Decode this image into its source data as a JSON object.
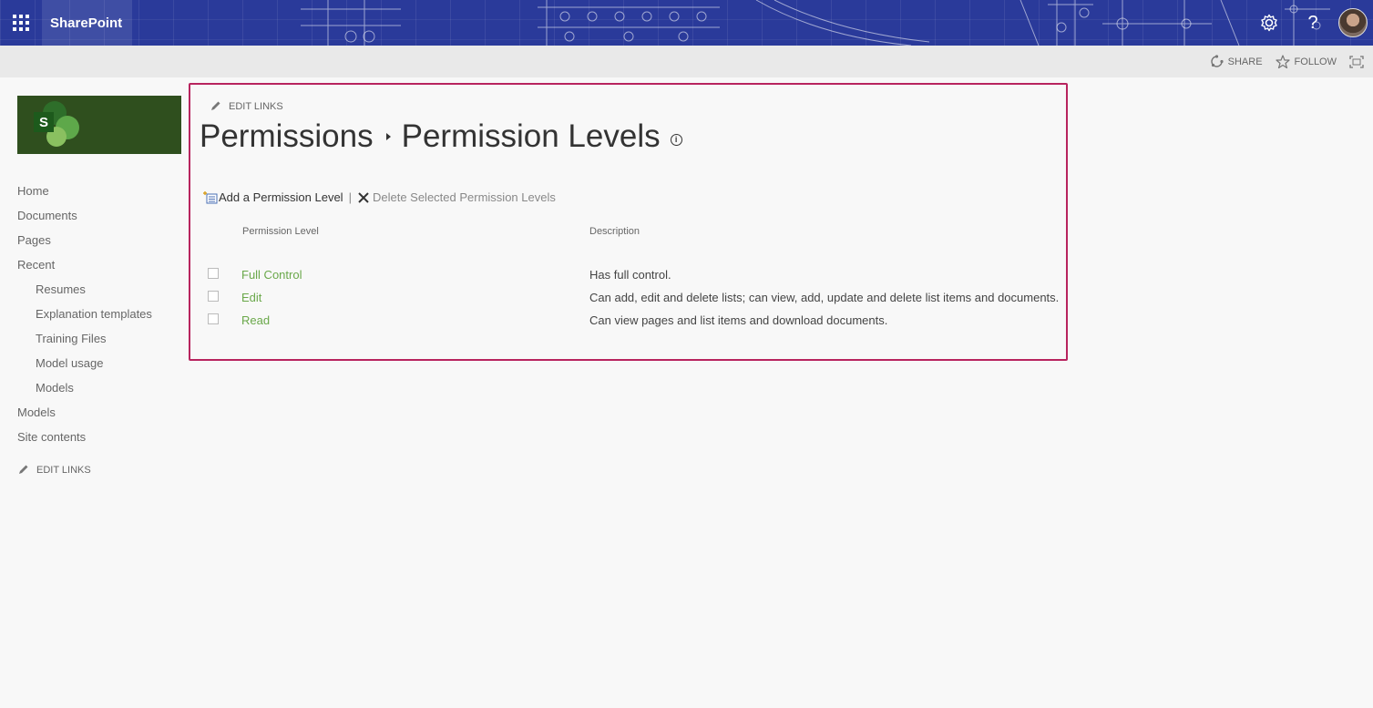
{
  "suite": {
    "brand": "SharePoint",
    "help_label": "?"
  },
  "ribbon": {
    "share_label": "SHARE",
    "follow_label": "FOLLOW"
  },
  "logo": {
    "letter": "S"
  },
  "leftnav": {
    "items": [
      {
        "label": "Home",
        "level": 0
      },
      {
        "label": "Documents",
        "level": 0
      },
      {
        "label": "Pages",
        "level": 0
      },
      {
        "label": "Recent",
        "level": 0
      },
      {
        "label": "Resumes",
        "level": 1
      },
      {
        "label": "Explanation templates",
        "level": 1
      },
      {
        "label": "Training Files",
        "level": 1
      },
      {
        "label": "Model usage",
        "level": 1
      },
      {
        "label": "Models",
        "level": 1
      },
      {
        "label": "Models",
        "level": 0
      },
      {
        "label": "Site contents",
        "level": 0
      }
    ],
    "edit_links": "EDIT LINKS"
  },
  "main": {
    "edit_links": "EDIT LINKS",
    "breadcrumb": [
      "Permissions",
      "Permission Levels"
    ],
    "info_icon": "i",
    "toolbar": {
      "add_label": "Add a Permission Level",
      "separator": "|",
      "delete_label": "Delete Selected Permission Levels"
    },
    "table": {
      "headers": {
        "level": "Permission Level",
        "description": "Description"
      },
      "rows": [
        {
          "level": "Full Control",
          "description": "Has full control."
        },
        {
          "level": "Edit",
          "description": "Can add, edit and delete lists; can view, add, update and delete list items and documents."
        },
        {
          "level": "Read",
          "description": "Can view pages and list items and download documents."
        }
      ]
    }
  },
  "colors": {
    "suitebar": "#2a3a9a",
    "link_green": "#6aa84a",
    "highlight_border": "#b8245e",
    "logo_bg": "#2f4f1e"
  },
  "icons": [
    "waffle-icon",
    "gear-icon",
    "help-icon",
    "share-icon",
    "star-icon",
    "focus-icon",
    "pencil-icon",
    "info-icon",
    "add-list-icon",
    "delete-x-icon"
  ]
}
